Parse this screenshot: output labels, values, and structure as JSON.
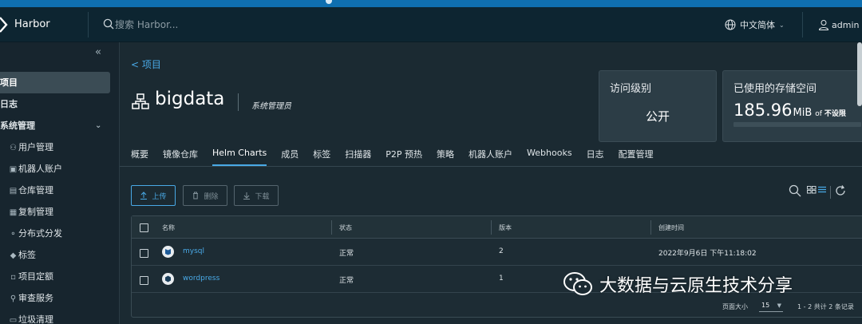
{
  "header": {
    "brand": "Harbor",
    "search_placeholder": "搜索 Harbor...",
    "language": "中文简体",
    "user": "admin"
  },
  "sidebar": {
    "items": [
      {
        "label": "项目",
        "icon": "project-icon"
      },
      {
        "label": "日志",
        "icon": "log-icon"
      },
      {
        "label": "系统管理",
        "icon": "admin-icon"
      },
      {
        "label": "用户管理",
        "icon": "users-icon"
      },
      {
        "label": "机器人账户",
        "icon": "robot-icon"
      },
      {
        "label": "仓库管理",
        "icon": "registry-icon"
      },
      {
        "label": "复制管理",
        "icon": "replication-icon"
      },
      {
        "label": "分布式分发",
        "icon": "distribution-icon"
      },
      {
        "label": "标签",
        "icon": "label-icon"
      },
      {
        "label": "项目定额",
        "icon": "quota-icon"
      },
      {
        "label": "审查服务",
        "icon": "scanner-icon"
      },
      {
        "label": "垃圾清理",
        "icon": "trash-icon"
      }
    ]
  },
  "project": {
    "back_label": "< 项目",
    "name": "bigdata",
    "role": "系统管理员"
  },
  "cards": {
    "access_label": "访问级别",
    "access_value": "公开",
    "storage_label": "已使用的存储空间",
    "storage_num": "185.96",
    "storage_unit": "MiB",
    "storage_of": "of",
    "storage_limit": "不设限",
    "storage_fill_fraction": 0.0
  },
  "tabs": [
    "概要",
    "镜像仓库",
    "Helm Charts",
    "成员",
    "标签",
    "扫描器",
    "P2P 预热",
    "策略",
    "机器人账户",
    "Webhooks",
    "日志",
    "配置管理"
  ],
  "active_tab": "Helm Charts",
  "actions": {
    "upload": "上传",
    "delete": "删除",
    "download": "下载"
  },
  "table": {
    "headers": [
      "名称",
      "状态",
      "版本",
      "创建时间"
    ],
    "rows": [
      {
        "name": "mysql",
        "status": "正常",
        "version": "2",
        "created": "2022年9月6日 下午11:18:02"
      },
      {
        "name": "wordpress",
        "status": "正常",
        "version": "1",
        "created": ""
      }
    ],
    "page_size_label": "页面大小",
    "page_size": "15",
    "range": "1 - 2 共计 2 条记录"
  },
  "watermark": {
    "text": "大数据与云原生技术分享"
  },
  "colors": {
    "accent": "#49a9e6",
    "header_bg": "#0d2531",
    "page_bg": "#1b2a32"
  }
}
